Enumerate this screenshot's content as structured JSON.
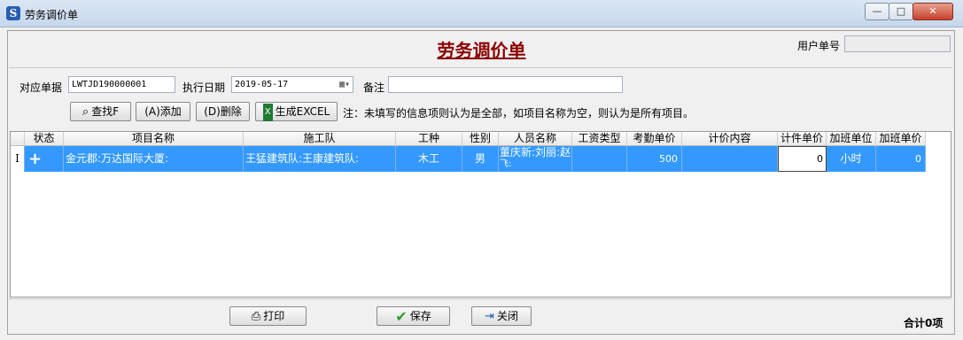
{
  "window": {
    "title": "劳务调价单",
    "icon": "app-s-icon",
    "minimize_label": "—",
    "maximize_label": "□",
    "close_label": "✕"
  },
  "header": {
    "doc_title": "劳务调价单",
    "user_no_label": "用户单号",
    "user_no_value": ""
  },
  "form": {
    "ref_label": "对应单据",
    "ref_value": "LWTJD190000001",
    "date_label": "执行日期",
    "date_value": "2019-05-17",
    "remark_label": "备注",
    "remark_value": ""
  },
  "toolbar": {
    "find_label": "查找F",
    "add_label": "(A)添加",
    "delete_label": "(D)删除",
    "excel_label": "生成EXCEL",
    "note": "注：未填写的信息项则认为是全部，如项目名称为空，则认为是所有项目。"
  },
  "table": {
    "columns": [
      "状态",
      "项目名称",
      "施工队",
      "工种",
      "性别",
      "人员名称",
      "工资类型",
      "考勤单价",
      "计价内容",
      "计件单价",
      "加班单位",
      "加班单价"
    ],
    "row": {
      "indicator": "I",
      "status": "+",
      "project": "金元郡:万达国际大厦:",
      "team": "王猛建筑队:王康建筑队:",
      "trade": "木工",
      "gender": "男",
      "persons_line1": "董庆新:刘丽:赵",
      "persons_line2": "飞:",
      "wage_type": "",
      "attendance_price": "500",
      "pricing_content": "",
      "piece_price": "0",
      "overtime_unit": "小时",
      "overtime_price": "0"
    }
  },
  "footer": {
    "print_label": "打印",
    "save_label": "保存",
    "close_label": "关闭",
    "total": "合计0项"
  }
}
